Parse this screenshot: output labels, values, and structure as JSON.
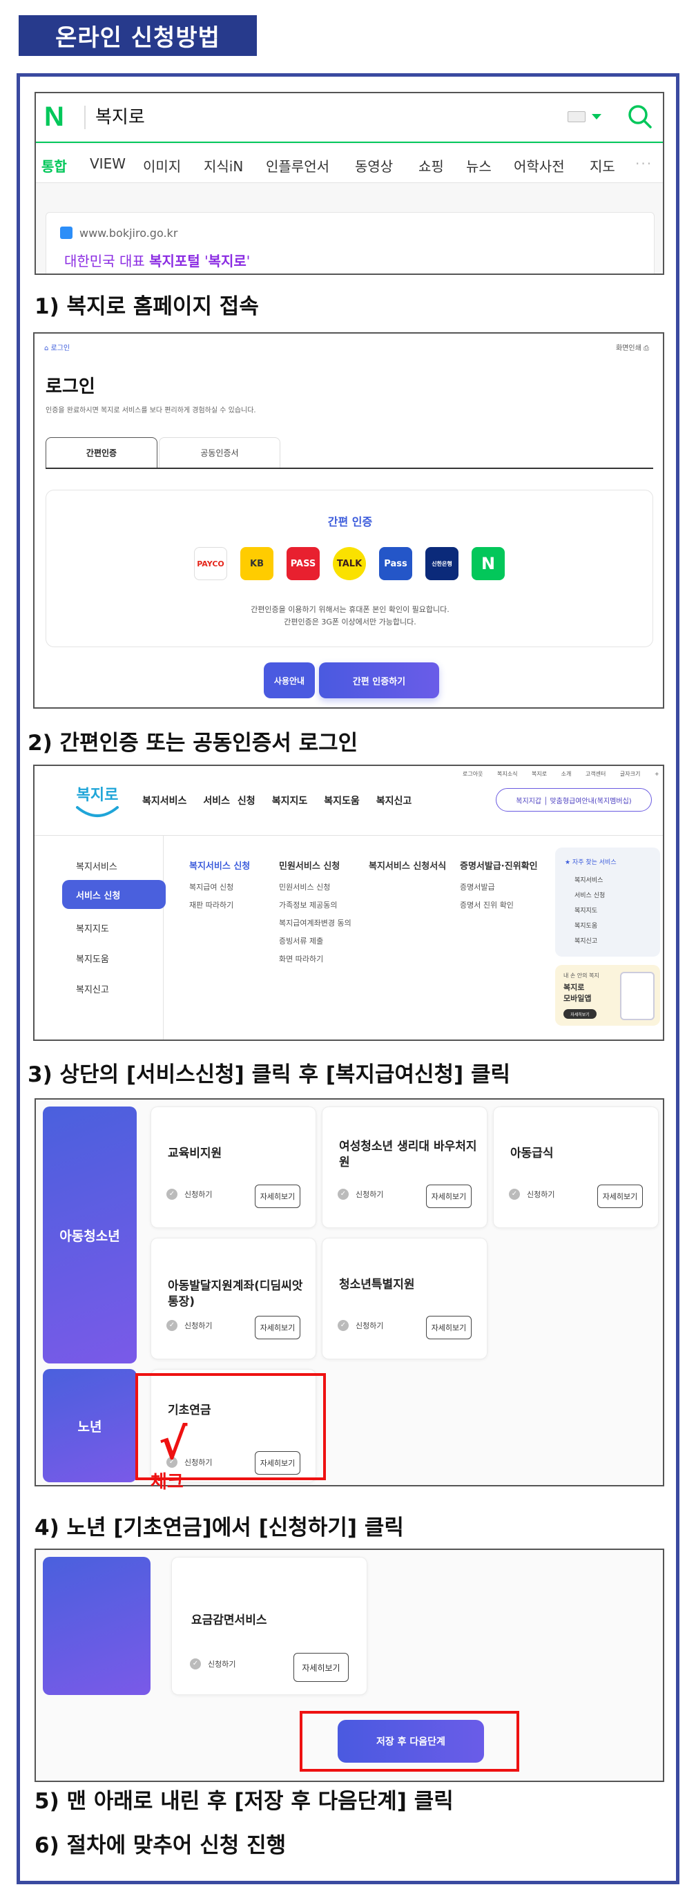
{
  "title": "온라인 신청방법",
  "steps": [
    "1) 복지로 홈페이지 접속",
    "2) 간편인증 또는 공동인증서 로그인",
    "3) 상단의 [서비스신청] 클릭 후 [복지급여신청] 클릭",
    "4) 노년 [기초연금]에서 [신청하기] 클릭",
    "5) 맨 아래로 내린 후 [저장 후 다음단계] 클릭",
    "6) 절차에 맞추어 신청 진행"
  ],
  "naver": {
    "logo": "N",
    "query": "복지로",
    "tabs": [
      "통합",
      "VIEW",
      "이미지",
      "지식iN",
      "인플루언서",
      "동영상",
      "쇼핑",
      "뉴스",
      "어학사전",
      "지도"
    ],
    "more": "···",
    "result_url": "www.bokjiro.go.kr",
    "result_title_a": "대한민국 대표 ",
    "result_title_b": "복지포털",
    "result_title_c": " '",
    "result_title_d": "복지로",
    "result_title_e": "'",
    "colors": {
      "brand": "#03c75a",
      "link": "#8a2be2"
    }
  },
  "login": {
    "breadcrumb": "로그인",
    "print": "화면인쇄",
    "heading": "로그인",
    "desc": "인증을 완료하시면 복지로 서비스를 보다 편리하게 경험하실 수 있습니다.",
    "tabs": [
      "간편인증",
      "공동인증서"
    ],
    "box_title": "간편 인증",
    "providers": [
      "PAYCO",
      "KB",
      "PASS",
      "TALK",
      "Pass",
      "신한은행",
      "N"
    ],
    "note1": "간편인증을 이용하기 위해서는 휴대폰 본인 확인이 필요합니다.",
    "note2": "간편인증은 3G폰 이상에서만 가능합니다.",
    "btn_guide": "사용안내",
    "btn_auth": "간편 인증하기"
  },
  "bokjiro": {
    "util": [
      "로그아웃",
      "복지소식",
      "복지로 소개",
      "고객센터",
      "글자크기",
      "+",
      "−"
    ],
    "logo": "복지로",
    "gnb": [
      "복지서비스",
      "서비스 신청",
      "복지지도",
      "복지도움",
      "복지신고"
    ],
    "pill": "복지지갑 │ 맞춤형급여안내(복지멤버십)",
    "side": [
      "복지서비스",
      "서비스 신청",
      "복지지도",
      "복지도움",
      "복지신고"
    ],
    "col1_head": "복지서비스 신청",
    "col1": [
      "복지급여 신청",
      "재판 따라하기"
    ],
    "col2_head": "민원서비스 신청",
    "col2": [
      "민원서비스 신청",
      "가족정보 제공동의",
      "복지급여계좌변경 동의",
      "증빙서류 제출",
      "화면 따라하기"
    ],
    "col3_head": "복지서비스 신청서식",
    "col4_head": "증명서발급·진위확인",
    "col4": [
      "증명서발급",
      "증명서 진위 확인"
    ],
    "fav_head": "★ 자주 찾는 서비스",
    "fav": [
      "복지서비스",
      "서비스 신청",
      "복지지도",
      "복지도움",
      "복지신고"
    ],
    "promo1": "내 손 안의 복지",
    "promo2": "복지로",
    "promo3": "모바일앱",
    "promo4": "자세히보기"
  },
  "cards": {
    "youth_label": "아동청소년",
    "elder_label": "노년",
    "apply": "신청하기",
    "detail": "자세히보기",
    "items": [
      "교육비지원",
      "여성청소년 생리대 바우처지원",
      "아동급식",
      "아동발달지원계좌(디딤씨앗통장)",
      "청소년특별지원"
    ],
    "elder_item": "기초연금",
    "check_mark": "√",
    "check_text": "체크"
  },
  "final": {
    "card_title": "요금감면서비스",
    "apply": "신청하기",
    "detail": "자세히보기",
    "next_btn": "저장 후 다음단계"
  },
  "colors": {
    "navy": "#273a8c",
    "frame": "#3a4aa0",
    "accent": "#4a60dd",
    "red": "#e11111"
  }
}
